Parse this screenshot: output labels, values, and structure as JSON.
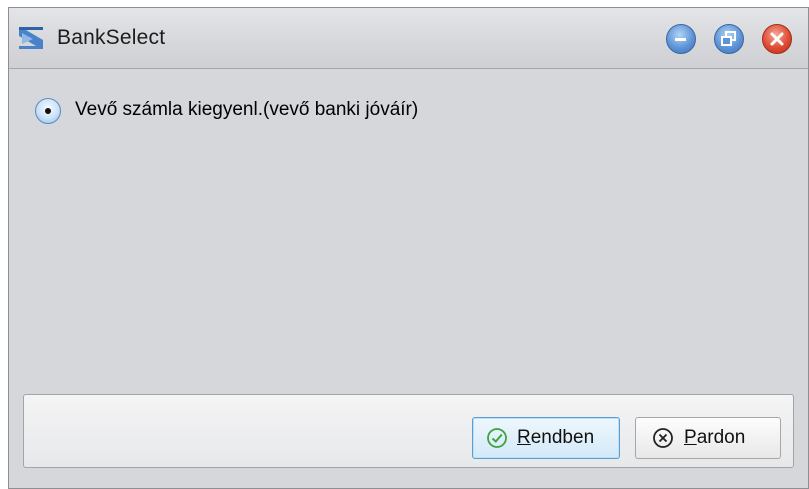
{
  "window": {
    "title": "BankSelect",
    "app_icon": "bank-select-app-icon",
    "titlebar_buttons": [
      {
        "name": "minimize",
        "icon": "minimize-icon"
      },
      {
        "name": "restore",
        "icon": "restore-icon"
      },
      {
        "name": "close",
        "icon": "close-icon"
      }
    ]
  },
  "options": [
    {
      "label": "Vevő számla kiegyenl.(vevő banki jóváír)",
      "selected": true
    }
  ],
  "buttons": {
    "ok": {
      "label": "Rendben",
      "icon": "check-circle-icon",
      "accelerator": "R"
    },
    "cancel": {
      "label": "Pardon",
      "icon": "x-circle-icon",
      "accelerator": "P"
    }
  },
  "colors": {
    "accent": "#5e95d6",
    "close": "#df4c34",
    "ok_icon": "#3fa33a"
  }
}
